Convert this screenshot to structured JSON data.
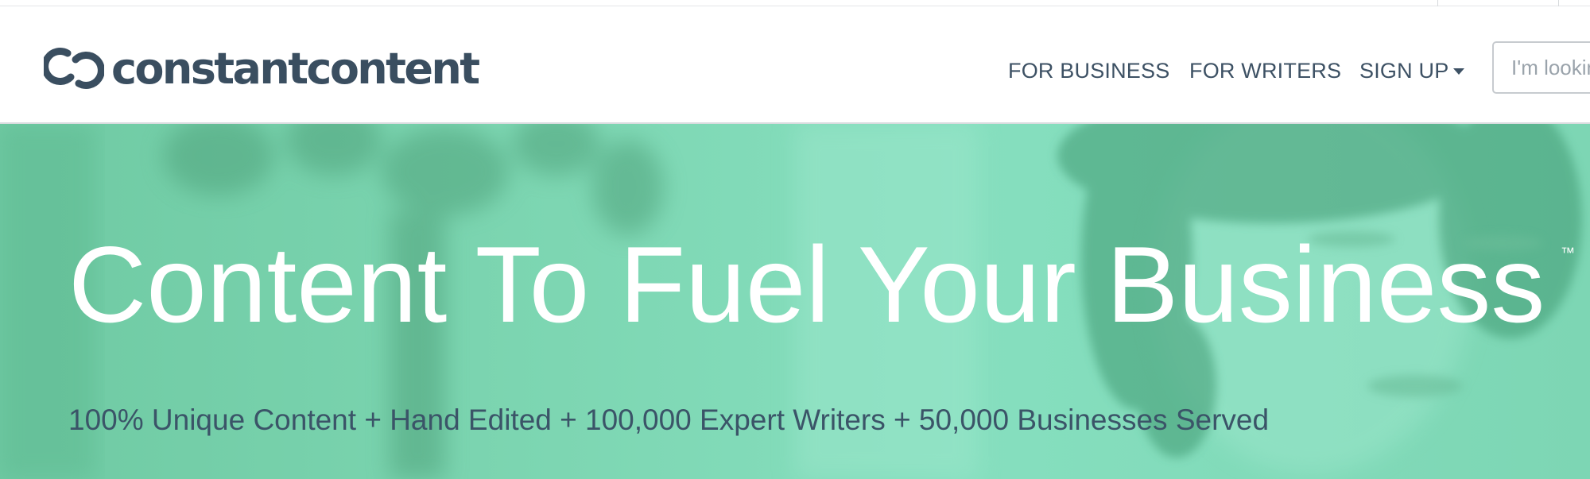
{
  "brand": {
    "name": "constantcontent",
    "logo_icon": "infinity-links-icon",
    "text_color": "#3a4e60"
  },
  "nav": {
    "items": [
      {
        "label": "FOR BUSINESS"
      },
      {
        "label": "FOR WRITERS"
      },
      {
        "label": "SIGN UP",
        "icon": "caret-down-icon"
      }
    ]
  },
  "search": {
    "placeholder": "I'm looking for..."
  },
  "hero": {
    "title": "Content To Fuel Your Business",
    "trademark": "™",
    "subtitle": "100% Unique Content + Hand Edited + 100,000 Expert Writers + 50,000 Businesses Served",
    "overlay_color": "#7dd6b2"
  }
}
